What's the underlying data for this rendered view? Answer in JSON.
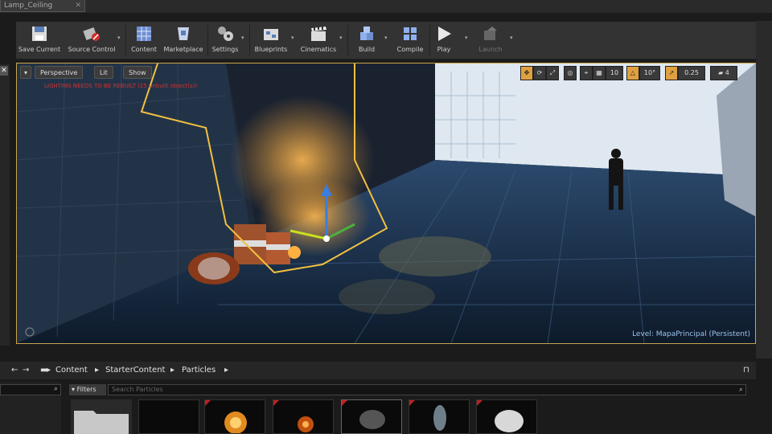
{
  "window": {
    "tab_title": "Lamp_Ceiling"
  },
  "toolbar": {
    "items": [
      {
        "label": "Save Current",
        "icon": "save-icon"
      },
      {
        "label": "Source Control",
        "icon": "source-control-icon"
      },
      {
        "label": "Content",
        "icon": "content-icon"
      },
      {
        "label": "Marketplace",
        "icon": "marketplace-icon"
      },
      {
        "label": "Settings",
        "icon": "settings-icon"
      },
      {
        "label": "Blueprints",
        "icon": "blueprints-icon"
      },
      {
        "label": "Cinematics",
        "icon": "cinematics-icon"
      },
      {
        "label": "Build",
        "icon": "build-icon"
      },
      {
        "label": "Compile",
        "icon": "compile-icon"
      },
      {
        "label": "Play",
        "icon": "play-icon"
      },
      {
        "label": "Launch",
        "icon": "launch-icon"
      }
    ]
  },
  "viewport": {
    "perspective_label": "Perspective",
    "lit_label": "Lit",
    "show_label": "Show",
    "grid_snap": "10",
    "rotation_snap": "10°",
    "scale_snap": "0.25",
    "camera_speed": "4",
    "level_label": "Level:",
    "level_name": "MapaPrincipal (Persistent)",
    "error_text": "LIGHTING NEEDS TO BE REBUILT (25 unbuilt object(s))"
  },
  "content_browser": {
    "path": [
      "Content",
      "StarterContent",
      "Particles"
    ],
    "filters_label": "Filters",
    "search_placeholder": "Search Particles"
  },
  "colors": {
    "accent": "#e0a040",
    "selection_outline": "#f0c040",
    "error": "#d03030"
  }
}
